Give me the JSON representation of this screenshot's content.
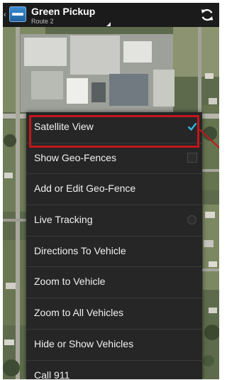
{
  "header": {
    "title": "Green Pickup",
    "subtitle": "Route 2"
  },
  "menu": {
    "items": [
      {
        "label": "Satellite View",
        "control": "checkbox",
        "checked": true,
        "highlighted": true
      },
      {
        "label": "Show Geo-Fences",
        "control": "checkbox",
        "checked": false
      },
      {
        "label": "Add or Edit Geo-Fence",
        "control": "none"
      },
      {
        "label": "Live Tracking",
        "control": "radio",
        "checked": false
      },
      {
        "label": "Directions To Vehicle",
        "control": "none"
      },
      {
        "label": "Zoom to Vehicle",
        "control": "none"
      },
      {
        "label": "Zoom to All Vehicles",
        "control": "none"
      },
      {
        "label": "Hide or Show Vehicles",
        "control": "none"
      },
      {
        "label": "Call 911",
        "control": "none"
      }
    ]
  },
  "colors": {
    "action_bar": "#1b1b1b",
    "menu_bg": "#262626",
    "check_accent": "#33b5e5",
    "highlight_box": "#c4161c"
  },
  "icons": {
    "up": "chevron-left-icon",
    "app": "app-logo-icon",
    "refresh": "refresh-icon",
    "spinner": "dropdown-triangle-icon",
    "check": "checkmark-icon"
  }
}
